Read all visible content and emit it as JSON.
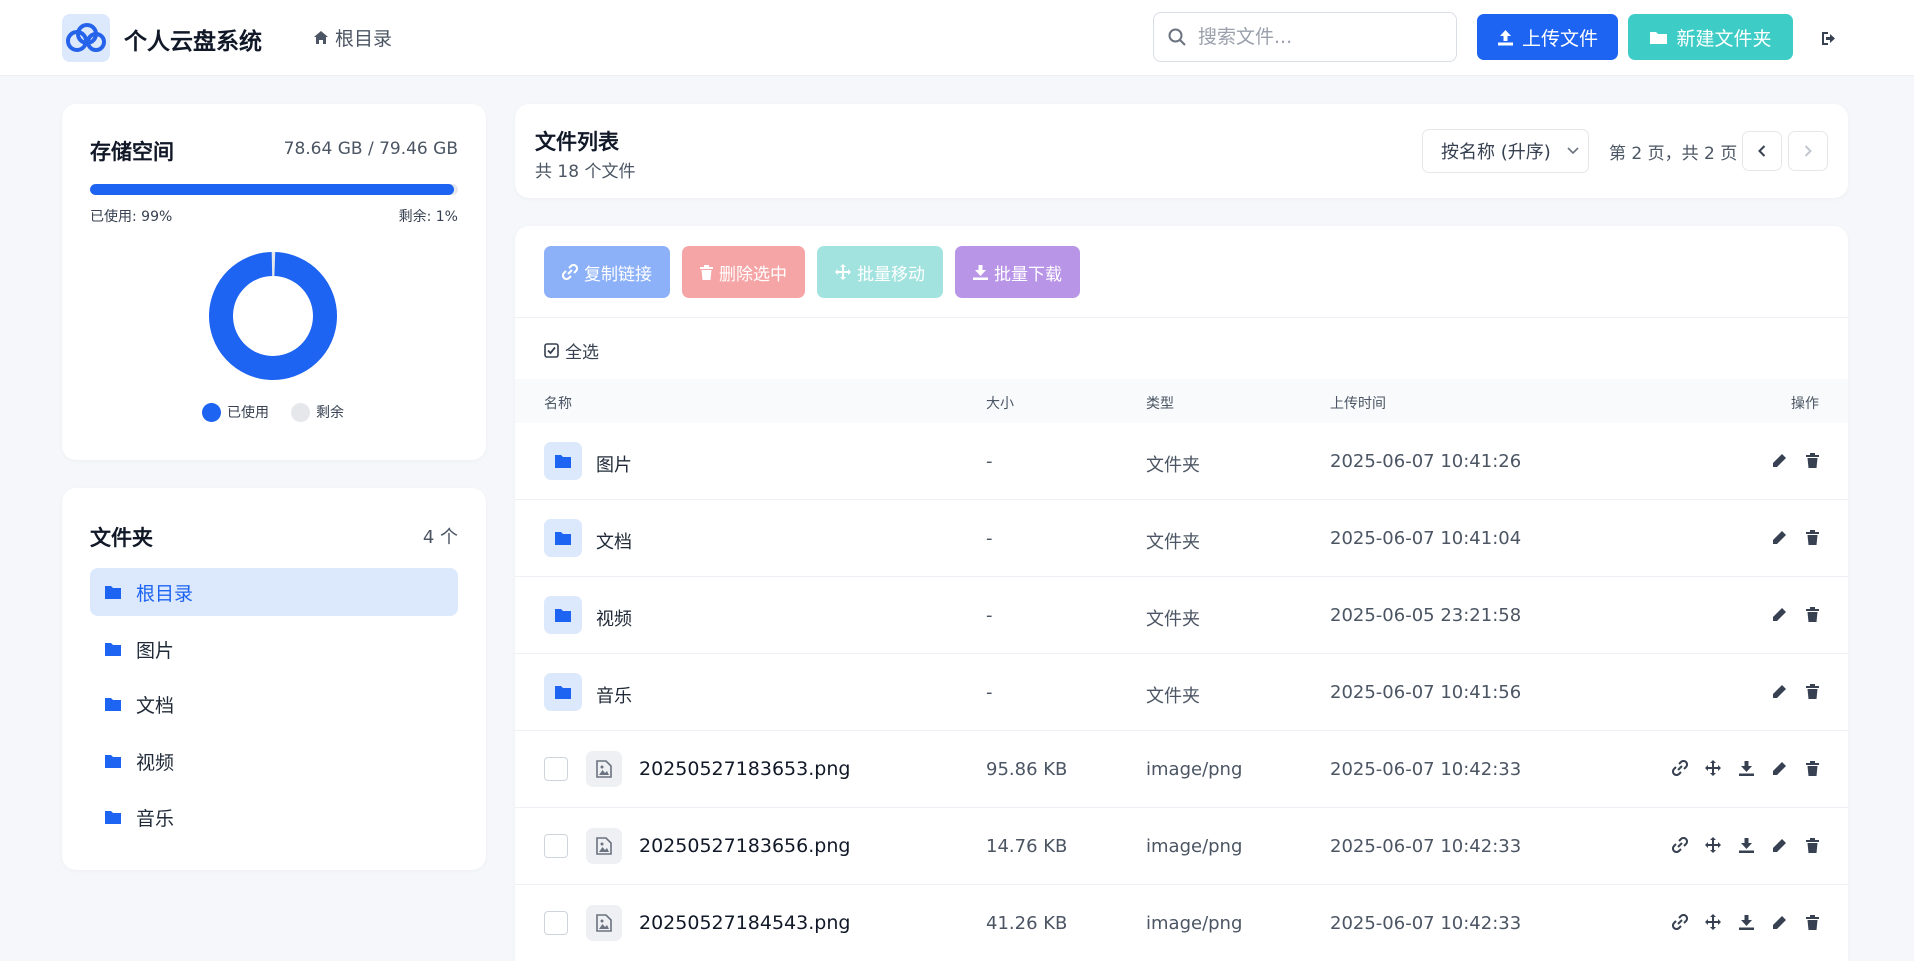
{
  "header": {
    "app_title": "个人云盘系统",
    "breadcrumb": "根目录",
    "search_placeholder": "搜索文件...",
    "upload_label": "上传文件",
    "new_folder_label": "新建文件夹"
  },
  "storage": {
    "title": "存储空间",
    "amount": "78.64 GB / 79.46 GB",
    "used_label": "已使用: 99%",
    "free_label": "剩余: 1%",
    "used_fraction": 0.99,
    "legend_used": "已使用",
    "legend_free": "剩余",
    "colors": {
      "used": "#1d64f2",
      "free": "#e5e7eb"
    }
  },
  "folders": {
    "title": "文件夹",
    "count": "4 个",
    "items": [
      {
        "label": "根目录",
        "active": true
      },
      {
        "label": "图片",
        "active": false
      },
      {
        "label": "文档",
        "active": false
      },
      {
        "label": "视频",
        "active": false
      },
      {
        "label": "音乐",
        "active": false
      }
    ]
  },
  "list": {
    "title": "文件列表",
    "subtitle": "共 18 个文件",
    "sort_value": "按名称 (升序)",
    "page_info": "第 2 页，共 2 页"
  },
  "bulk": {
    "copy_link": "复制链接",
    "delete_selected": "删除选中",
    "batch_move": "批量移动",
    "batch_download": "批量下载",
    "select_all": "全选"
  },
  "table": {
    "headers": {
      "name": "名称",
      "size": "大小",
      "type": "类型",
      "time": "上传时间",
      "ops": "操作"
    },
    "folder_rows": [
      {
        "name": "图片",
        "size": "-",
        "type": "文件夹",
        "time": "2025-06-07 10:41:26"
      },
      {
        "name": "文档",
        "size": "-",
        "type": "文件夹",
        "time": "2025-06-07 10:41:04"
      },
      {
        "name": "视频",
        "size": "-",
        "type": "文件夹",
        "time": "2025-06-05 23:21:58"
      },
      {
        "name": "音乐",
        "size": "-",
        "type": "文件夹",
        "time": "2025-06-07 10:41:56"
      }
    ],
    "file_rows": [
      {
        "name": "20250527183653.png",
        "size": "95.86 KB",
        "type": "image/png",
        "time": "2025-06-07 10:42:33"
      },
      {
        "name": "20250527183656.png",
        "size": "14.76 KB",
        "type": "image/png",
        "time": "2025-06-07 10:42:33"
      },
      {
        "name": "20250527184543.png",
        "size": "41.26 KB",
        "type": "image/png",
        "time": "2025-06-07 10:42:33"
      }
    ]
  }
}
